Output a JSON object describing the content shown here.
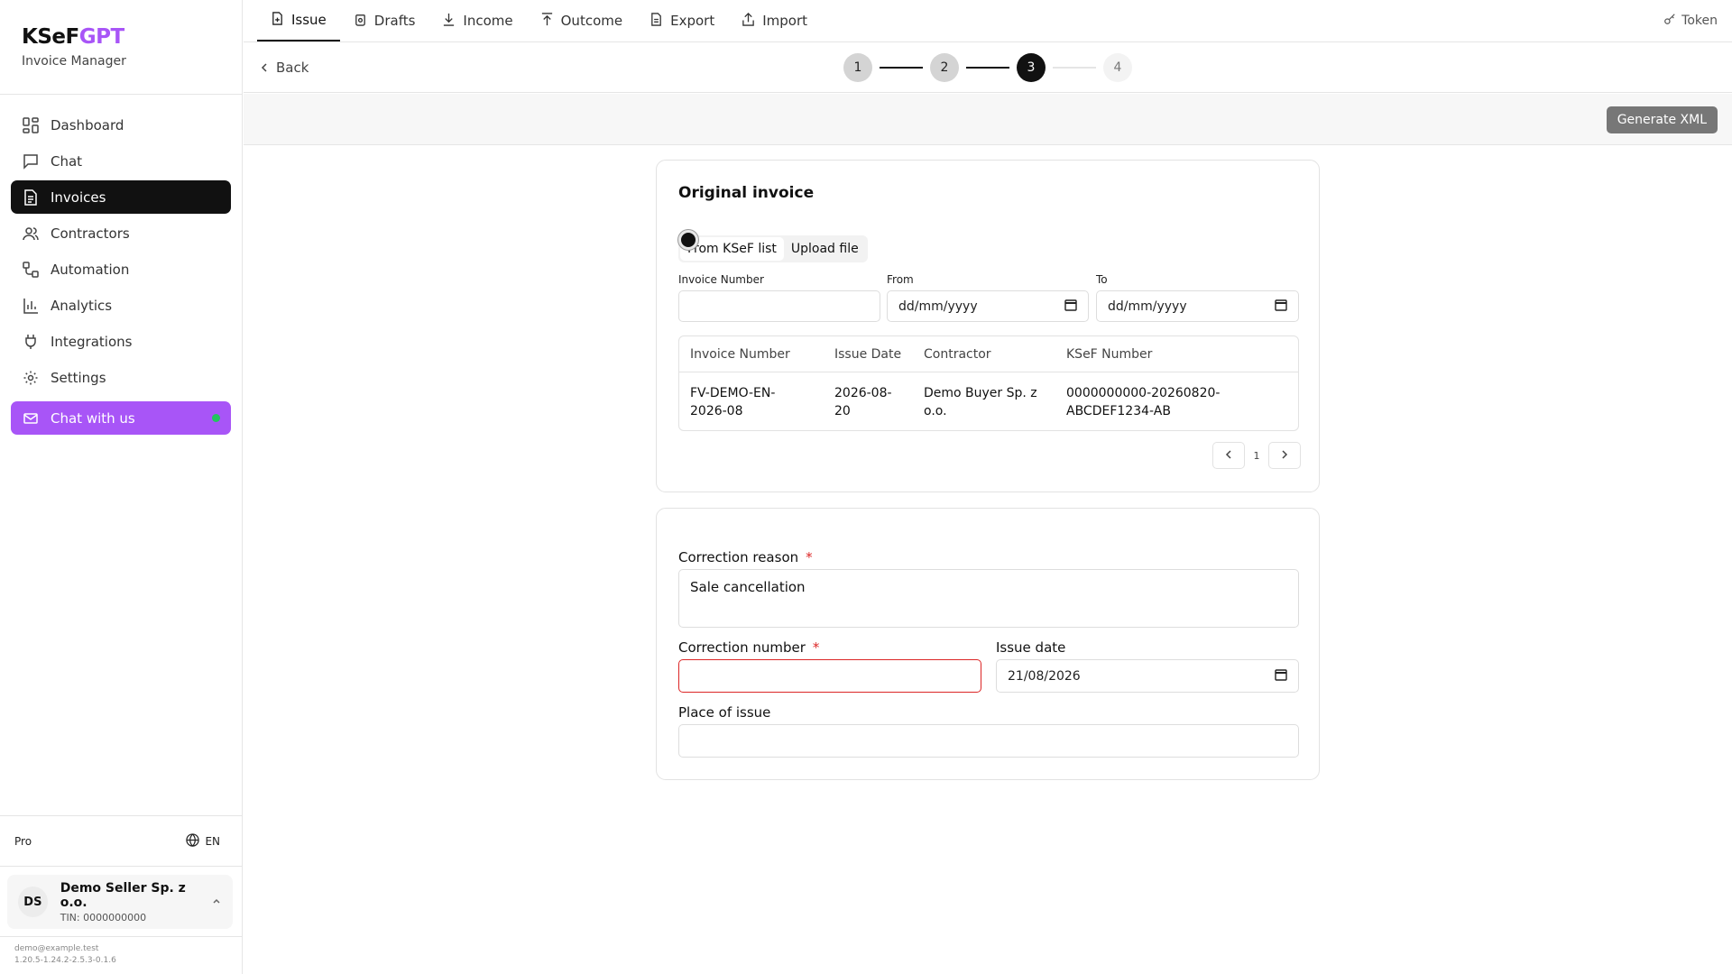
{
  "brand": {
    "title_main": "KSeF",
    "title_accent": "GPT",
    "subtitle": "Invoice Manager"
  },
  "sidebar": {
    "items": [
      {
        "label": "Dashboard",
        "icon": "dashboard-icon"
      },
      {
        "label": "Chat",
        "icon": "chat-icon"
      },
      {
        "label": "Invoices",
        "icon": "invoice-icon",
        "active": true
      },
      {
        "label": "Contractors",
        "icon": "users-icon"
      },
      {
        "label": "Automation",
        "icon": "workflow-icon"
      },
      {
        "label": "Analytics",
        "icon": "bar-chart-icon"
      },
      {
        "label": "Integrations",
        "icon": "plug-icon"
      },
      {
        "label": "Settings",
        "icon": "gear-icon"
      }
    ],
    "chat_us": "Chat with us",
    "plan": "Pro",
    "language": "EN",
    "user": {
      "initials": "DS",
      "name": "Demo Seller Sp. z o.o.",
      "tin": "TIN: 0000000000"
    },
    "email": "demo@example.test",
    "version": "1.20.5-1.24.2-2.5.3-0.1.6"
  },
  "topbar": {
    "tabs": [
      "Issue",
      "Drafts",
      "Income",
      "Outcome",
      "Export",
      "Import"
    ],
    "active_tab": "Issue",
    "token": "Token"
  },
  "stepper": {
    "back": "Back",
    "steps": [
      "1",
      "2",
      "3",
      "4"
    ],
    "current": 3
  },
  "actions": {
    "generate": "Generate XML"
  },
  "original_invoice": {
    "title": "Original invoice",
    "source_tabs": [
      "From KSeF list",
      "Upload file"
    ],
    "filters": {
      "invoice_number_label": "Invoice Number",
      "from_label": "From",
      "from_value": "dd/mm/yyyy",
      "to_label": "To",
      "to_value": "dd/mm/yyyy"
    },
    "table": {
      "columns": [
        "Invoice Number",
        "Issue Date",
        "Contractor",
        "KSeF Number"
      ],
      "rows": [
        [
          "FV-DEMO-EN-2026-08",
          "2026-08-20",
          "Demo Buyer Sp. z o.o.",
          "0000000000-20260820-ABCDEF1234-AB"
        ]
      ]
    },
    "pager": {
      "page": "1"
    }
  },
  "correction": {
    "reason_label": "Correction reason",
    "reason_value": "Sale cancellation",
    "number_label": "Correction number",
    "number_value": "",
    "issue_date_label": "Issue date",
    "issue_date_value": "21/08/2026",
    "place_label": "Place of issue",
    "place_value": "",
    "required_mark": "*"
  },
  "colors": {
    "accent": "#a855f7",
    "error": "#dc2626",
    "online": "#22c55e"
  }
}
